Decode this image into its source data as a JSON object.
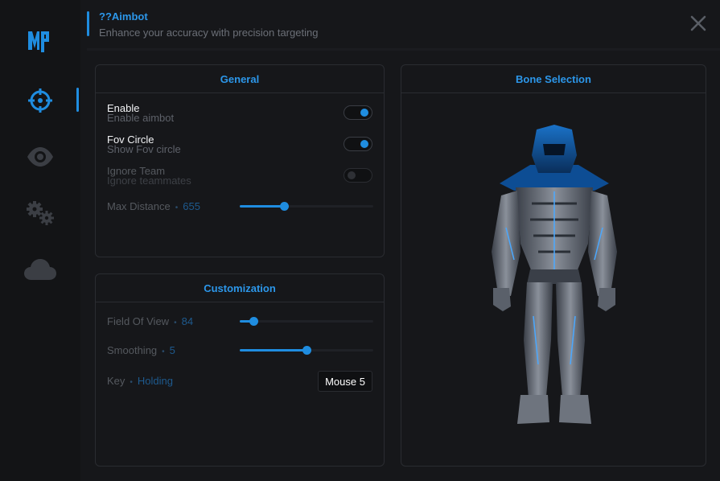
{
  "header": {
    "title": "??Aimbot",
    "subtitle": "Enhance your accuracy with precision targeting"
  },
  "sidebar": {
    "logo": "MP-logo",
    "items": [
      {
        "icon": "crosshair-icon",
        "active": true
      },
      {
        "icon": "eye-icon",
        "active": false
      },
      {
        "icon": "gears-icon",
        "active": false
      },
      {
        "icon": "cloud-icon",
        "active": false
      }
    ]
  },
  "general": {
    "title": "General",
    "enable": {
      "label": "Enable",
      "desc": "Enable aimbot",
      "on": true
    },
    "fov_circle": {
      "label": "Fov Circle",
      "desc": "Show Fov circle",
      "on": true
    },
    "ignore_team": {
      "label": "Ignore Team",
      "desc": "Ignore teammates",
      "on": false
    },
    "max_distance": {
      "label": "Max Distance",
      "value": "655",
      "fraction": 0.33
    }
  },
  "customization": {
    "title": "Customization",
    "fov": {
      "label": "Field Of View",
      "value": "84",
      "fraction": 0.1
    },
    "smoothing": {
      "label": "Smoothing",
      "value": "5",
      "fraction": 0.5
    },
    "key": {
      "label": "Key",
      "mode": "Holding",
      "value": "Mouse 5"
    }
  },
  "bone_selection": {
    "title": "Bone Selection"
  },
  "colors": {
    "accent": "#1f8de0",
    "background": "#16171a",
    "panel_border": "#2a2c31"
  }
}
